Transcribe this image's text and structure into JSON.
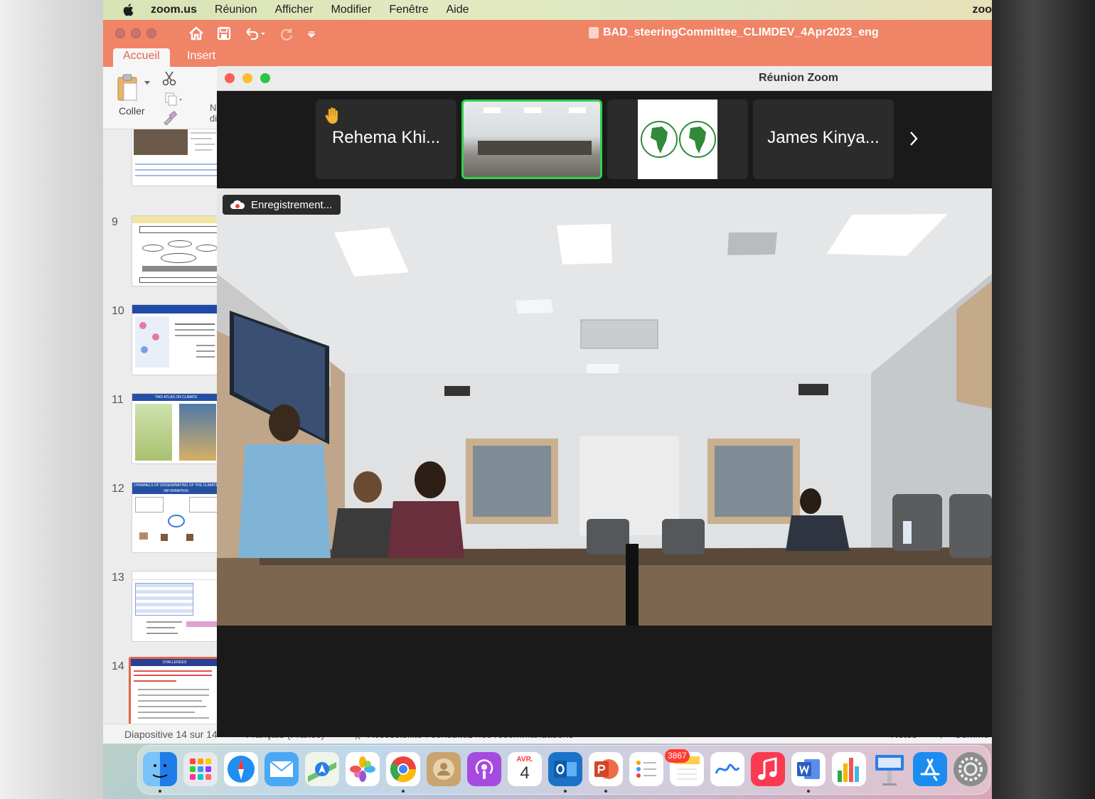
{
  "menubar": {
    "app_name": "zoom.us",
    "items": [
      "Réunion",
      "Afficher",
      "Modifier",
      "Fenêtre",
      "Aide"
    ],
    "right_label": "zoo"
  },
  "powerpoint": {
    "document_title": "BAD_steeringCommittee_CLIMDEV_4Apr2023_eng",
    "tabs": {
      "active": "Accueil",
      "second": "Insert"
    },
    "ribbon": {
      "paste_label": "Coller",
      "new_slide_label_a": "N",
      "new_slide_label_b": "dia"
    },
    "slide_numbers": [
      "9",
      "10",
      "11",
      "12",
      "13",
      "14"
    ],
    "thumb_titles": {
      "s11": "TWO ATLAS ON CLIMATE",
      "s12": "CHANNELS OF DISSEMINATING OF THE CLIMATE INFORMATION",
      "s14": "CHALLENGES"
    },
    "status": {
      "slide_counter": "Diapositive 14 sur 14",
      "language": "Français (France)",
      "accessibility": "Accessibilité : consultez nos recommandations",
      "notes": "Notes",
      "comments": "Comme"
    }
  },
  "zoom": {
    "window_title": "Réunion Zoom",
    "participants": [
      {
        "name": "Rehema Khi..."
      },
      {
        "name": "James Kinya..."
      }
    ],
    "recording_label": "Enregistrement..."
  },
  "dock": {
    "calendar_month": "AVR.",
    "calendar_day": "4",
    "outlook_badge": "3867",
    "colors": {
      "finder": "#3b9df2",
      "safari": "#1e8ff0",
      "mail": "#4aa8f5",
      "chrome": "#e8453c",
      "podcasts": "#a64ae0",
      "outlook": "#1a73c8",
      "powerpoint": "#d24726",
      "music": "#fb3a52",
      "word": "#2b5fbd",
      "appstore": "#1d8cf0"
    }
  }
}
